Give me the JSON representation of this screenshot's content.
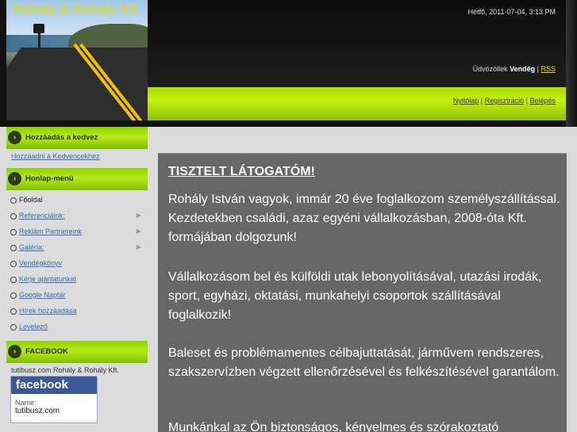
{
  "header": {
    "site_title": "Rohály & Rohály Kft.",
    "datetime": "Hétfő, 2011-07-04, 3:13 PM",
    "welcome_prefix": "Üdvözöllek ",
    "welcome_user": "Vendég",
    "separator": " | ",
    "rss_label": "RSS",
    "links": [
      "Nyitólap",
      "Regisztráció",
      "Belépés"
    ],
    "accent_color": "#b6ea1a"
  },
  "sidebar": {
    "bookmark_block": {
      "title": "Hozzáadás a kedvez",
      "link": "Hozzáadni a Kedvencekhez"
    },
    "menu_block": {
      "title": "Honlap-menü",
      "items": [
        {
          "label": "Főoldal",
          "has_sub": false,
          "plain": true
        },
        {
          "label": "Referenciáink:",
          "has_sub": true,
          "plain": false
        },
        {
          "label": "Reklám Partnereink",
          "has_sub": true,
          "plain": false
        },
        {
          "label": "Galéria:",
          "has_sub": true,
          "plain": false
        },
        {
          "label": "Vendégkönyv",
          "has_sub": false,
          "plain": false
        },
        {
          "label": "Kérje ajánlatunkat",
          "has_sub": false,
          "plain": false
        },
        {
          "label": "Google Naptár",
          "has_sub": false,
          "plain": false
        },
        {
          "label": "Hírek hozzáadása",
          "has_sub": false,
          "plain": false
        },
        {
          "label": "Levelező",
          "has_sub": false,
          "plain": false
        }
      ],
      "sub_arrow": "▶"
    },
    "facebook_block": {
      "title": "FACEBOOK",
      "caption": "tutibusz.com Rohály & Rohály Kft.",
      "logo": "facebook",
      "name_label": "Name:",
      "name_value": "tutibusz.com"
    },
    "arrow_glyph": "›"
  },
  "main": {
    "heading": "TISZTELT LÁTOGATÓM!",
    "paragraphs": [
      "Rohály István vagyok,  immár 20 éve foglalkozom személyszállítással. Kezdetekben családi, azaz egyéni vállalkozásban, 2008-óta Kft. formájában dolgozunk!",
      "Vállalkozásom bel és külföldi utak lebonyolításával, utazási irodák, sport, egyházi, oktatási, munkahelyi csoportok szállításával foglalkozik!",
      "Baleset és problémamentes célbajuttatását, járművem rendszeres, szakszervízben végzett ellenőrzésével és felkészítésével garantálom.",
      "Munkánkal az Ön biztonságos, kényelmes és szórakoztató"
    ]
  }
}
